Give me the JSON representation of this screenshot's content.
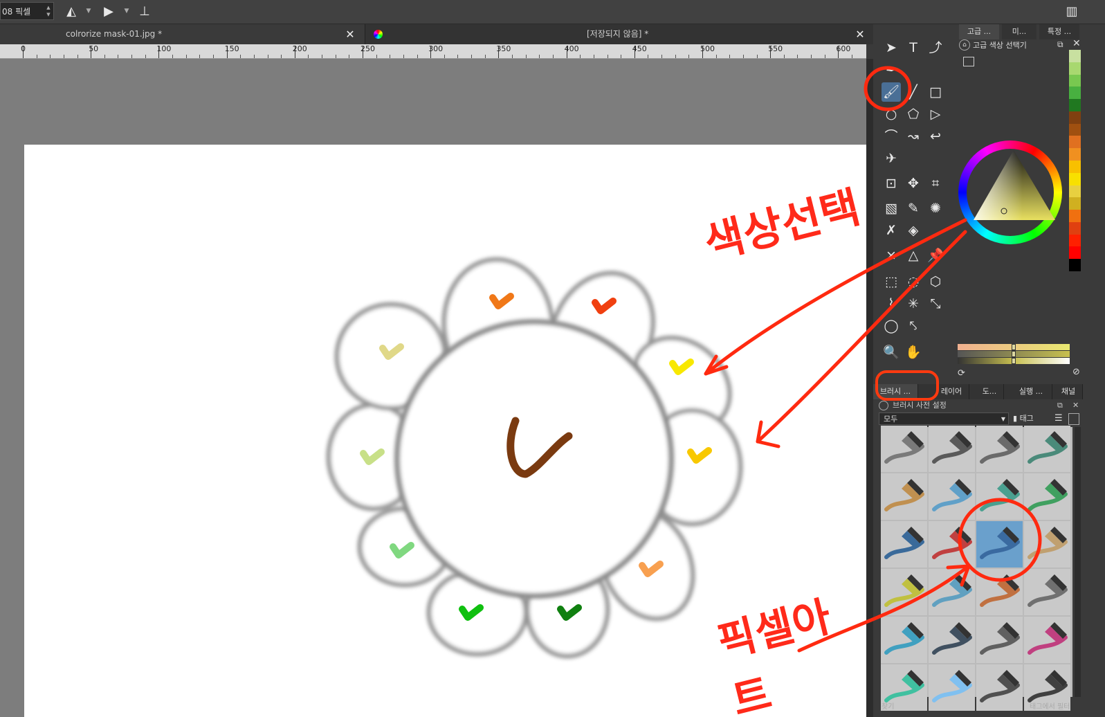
{
  "toolbar": {
    "brush_size": "08 픽셀",
    "icons": [
      "mirror-horizontal-icon",
      "mirror-vertical-icon",
      "wrap-around-icon"
    ]
  },
  "tabs": [
    {
      "label": "colrorize mask-01.jpg *"
    },
    {
      "label": "[저장되지 않음]  *"
    }
  ],
  "ruler": {
    "labels": [
      "0",
      "50",
      "100",
      "150",
      "200",
      "250",
      "300",
      "350",
      "400",
      "450",
      "500",
      "550",
      "600"
    ]
  },
  "color_docker": {
    "tabs": [
      "고급 ...",
      "미...",
      "특정 ..."
    ],
    "title": "고급 색상 선택기",
    "palette": [
      "#c8e0a0",
      "#a8d870",
      "#78c850",
      "#48b040",
      "#207820",
      "#804010",
      "#a05010",
      "#e07020",
      "#f09020",
      "#f8c000",
      "#f8e000",
      "#e8d040",
      "#d0b020",
      "#f07010",
      "#e04010",
      "#ff2000",
      "#ff0000",
      "#000000"
    ],
    "slider_colors": [
      "#f0b090",
      "#c8c050",
      "#e8e870"
    ]
  },
  "lower_tabs": [
    "브러시 ...",
    "레이어",
    "도...",
    "실행 ...",
    "채널"
  ],
  "brush_presets": {
    "title": "브러시 사전 설정",
    "filter": "모두",
    "tag_label": "태그",
    "search_placeholder": "찾기",
    "filter_by_tag": "태그에서 필터"
  },
  "annotations": {
    "color_select": "색상선택",
    "pixel_art": "픽셀아트"
  },
  "drawing": {
    "petal_checks": [
      "#f07818",
      "#f04010",
      "#f8e800",
      "#f8c800",
      "#f8a050",
      "#108010",
      "#10c010",
      "#80d880",
      "#c8e088",
      "#e0d888"
    ],
    "center_check": "#7a3a10"
  }
}
